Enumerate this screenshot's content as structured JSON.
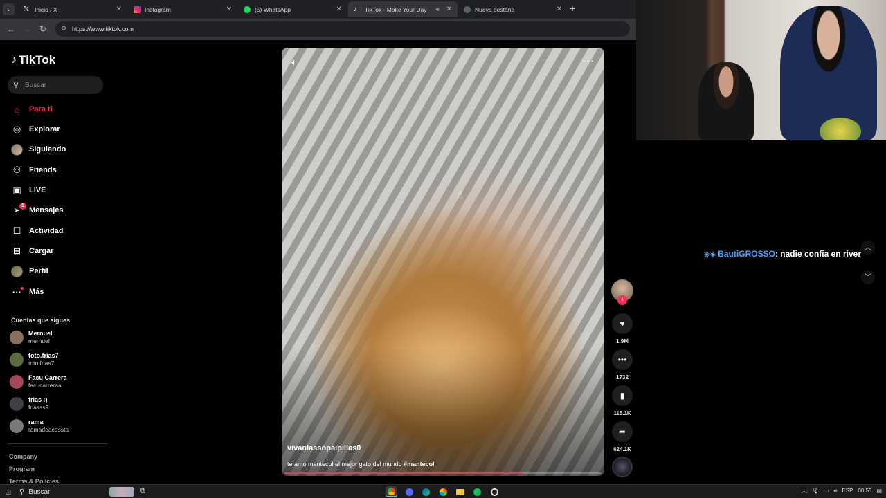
{
  "browser": {
    "tabs": [
      {
        "title": "Inicio / X",
        "favicon": "x-logo-icon",
        "active": false
      },
      {
        "title": "Instagram",
        "favicon": "instagram-icon",
        "active": false
      },
      {
        "title": "(5) WhatsApp",
        "favicon": "whatsapp-icon",
        "active": false
      },
      {
        "title": "TikTok - Make Your Day",
        "favicon": "tiktok-icon",
        "active": true,
        "audio": true
      },
      {
        "title": "Nueva pestaña",
        "favicon": "chrome-icon",
        "active": false
      }
    ],
    "url": "https://www.tiktok.com"
  },
  "sidebar": {
    "logo_text": "TikTok",
    "search_placeholder": "Buscar",
    "nav": [
      {
        "label": "Para ti",
        "icon": "home-icon",
        "active": true
      },
      {
        "label": "Explorar",
        "icon": "compass-icon"
      },
      {
        "label": "Siguiendo",
        "icon": "following-avatar-icon"
      },
      {
        "label": "Friends",
        "icon": "friends-icon"
      },
      {
        "label": "LIVE",
        "icon": "live-icon"
      },
      {
        "label": "Mensajes",
        "icon": "send-icon",
        "badge": "1"
      },
      {
        "label": "Actividad",
        "icon": "activity-icon"
      },
      {
        "label": "Cargar",
        "icon": "upload-icon"
      },
      {
        "label": "Perfil",
        "icon": "profile-avatar-icon"
      },
      {
        "label": "Más",
        "icon": "more-icon"
      }
    ],
    "following_title": "Cuentas que sigues",
    "accounts": [
      {
        "name": "Mernuel",
        "username": "mernuel",
        "color": "#8a6f5c"
      },
      {
        "name": "toto.frias7",
        "username": "toto.frias7",
        "color": "#5b6b3e"
      },
      {
        "name": "Facu Carrera",
        "username": "facucarreraa",
        "color": "#a3485a"
      },
      {
        "name": "frias :)",
        "username": "friasss9",
        "color": "#3f3f46"
      },
      {
        "name": "rama",
        "username": "ramadeacossta",
        "color": "#7a7a7a"
      }
    ],
    "footer": [
      "Company",
      "Program",
      "Terms & Policies"
    ]
  },
  "video": {
    "author": "vivanlassopaipillas0",
    "caption_text": "te amo mantecol el mejor gato del mundo ",
    "caption_tag": "#mantecol",
    "progress": 0.75,
    "likes": "1.9M",
    "comments": "1732",
    "saves": "115.1K",
    "shares": "624.1K",
    "accent_color": "#fe2c55"
  },
  "chat": {
    "username": "BautiGROSSO",
    "message": ": nadie confia en river"
  },
  "taskbar": {
    "search_label": "Buscar",
    "language": "ESP",
    "time": "00:55"
  }
}
